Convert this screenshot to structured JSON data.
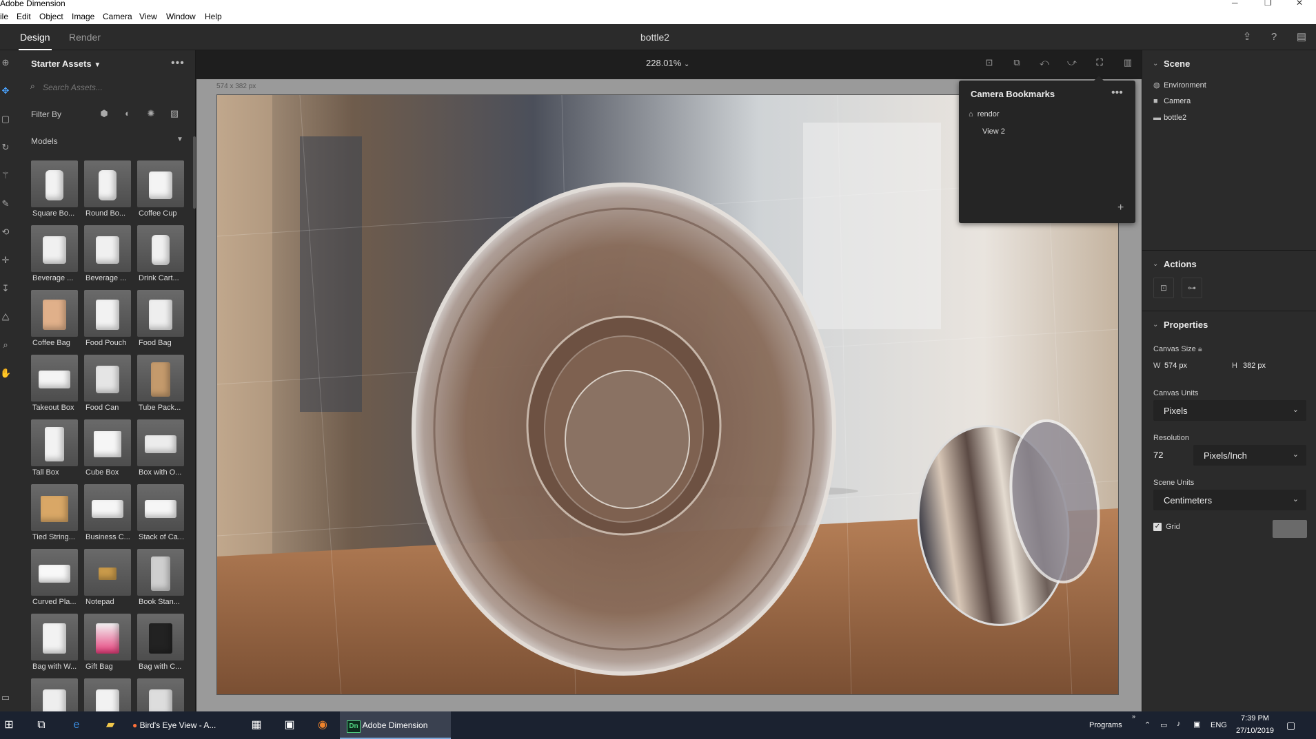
{
  "window": {
    "title": "Adobe Dimension",
    "controls": {
      "minimize": "─",
      "maximize": "❐",
      "close": "✕"
    }
  },
  "menubar": {
    "items": [
      "ile",
      "Edit",
      "Object",
      "Image",
      "Camera",
      "View",
      "Window",
      "Help"
    ]
  },
  "header": {
    "tabs": [
      {
        "label": "Design",
        "active": true
      },
      {
        "label": "Render",
        "active": false
      }
    ],
    "document_title": "bottle2",
    "icons": [
      "share-icon",
      "help-icon",
      "feedback-icon"
    ]
  },
  "tools": [
    "add-icon",
    "select-icon",
    "orbit-icon",
    "rotate-icon",
    "magic-wand-icon",
    "eyedropper-icon",
    "paint-icon",
    "move-icon",
    "drop-icon",
    "horizon-icon",
    "zoom-icon",
    "pan-icon"
  ],
  "assets": {
    "title": "Starter Assets",
    "search_placeholder": "Search Assets...",
    "filter_label": "Filter By",
    "filters": [
      "models-filter-icon",
      "materials-filter-icon",
      "lights-filter-icon",
      "images-filter-icon"
    ],
    "section": "Models",
    "items": [
      "Square Bo...",
      "Round Bo...",
      "Coffee Cup",
      "Beverage ...",
      "Beverage ...",
      "Drink Cart...",
      "Coffee Bag",
      "Food Pouch",
      "Food Bag",
      "Takeout Box",
      "Food Can",
      "Tube Pack...",
      "Tall Box",
      "Cube Box",
      "Box with O...",
      "Tied String...",
      "Business C...",
      "Stack of Ca...",
      "Curved Pla...",
      "Notepad",
      "Book Stan...",
      "Bag with W...",
      "Gift Bag",
      "Bag with C...",
      "",
      "",
      ""
    ]
  },
  "canvas": {
    "zoom": "228.01%",
    "size_label": "574 x 382 px",
    "toolbar_icons": [
      "fit-icon",
      "camera-frame-icon",
      "undo-view-icon",
      "redo-view-icon",
      "camera-bookmark-icon",
      "render-preview-icon"
    ]
  },
  "bookmarks": {
    "title": "Camera Bookmarks",
    "items": [
      {
        "label": "rendor",
        "home": true
      },
      {
        "label": "View 2",
        "home": false
      }
    ],
    "add_label": "+"
  },
  "scene": {
    "title": "Scene",
    "items": [
      {
        "label": "Environment",
        "icon": "environment-icon"
      },
      {
        "label": "Camera",
        "icon": "camera-icon"
      },
      {
        "label": "bottle2",
        "icon": "folder-icon"
      }
    ]
  },
  "actions": {
    "title": "Actions"
  },
  "properties": {
    "title": "Properties",
    "canvas_size_label": "Canvas Size",
    "w_label": "W",
    "w_value": "574 px",
    "h_label": "H",
    "h_value": "382 px",
    "canvas_units_label": "Canvas Units",
    "canvas_units_value": "Pixels",
    "resolution_label": "Resolution",
    "resolution_value": "72",
    "resolution_unit": "Pixels/Inch",
    "scene_units_label": "Scene Units",
    "scene_units_value": "Centimeters",
    "grid_label": "Grid",
    "grid_checked": true
  },
  "taskbar": {
    "apps": [
      {
        "label": "Bird's Eye View - A...",
        "active": false
      },
      {
        "label": "Adobe Dimension",
        "active": true
      }
    ],
    "programs_label": "Programs",
    "lang": "ENG",
    "time": "7:39 PM",
    "date": "27/10/2019"
  }
}
